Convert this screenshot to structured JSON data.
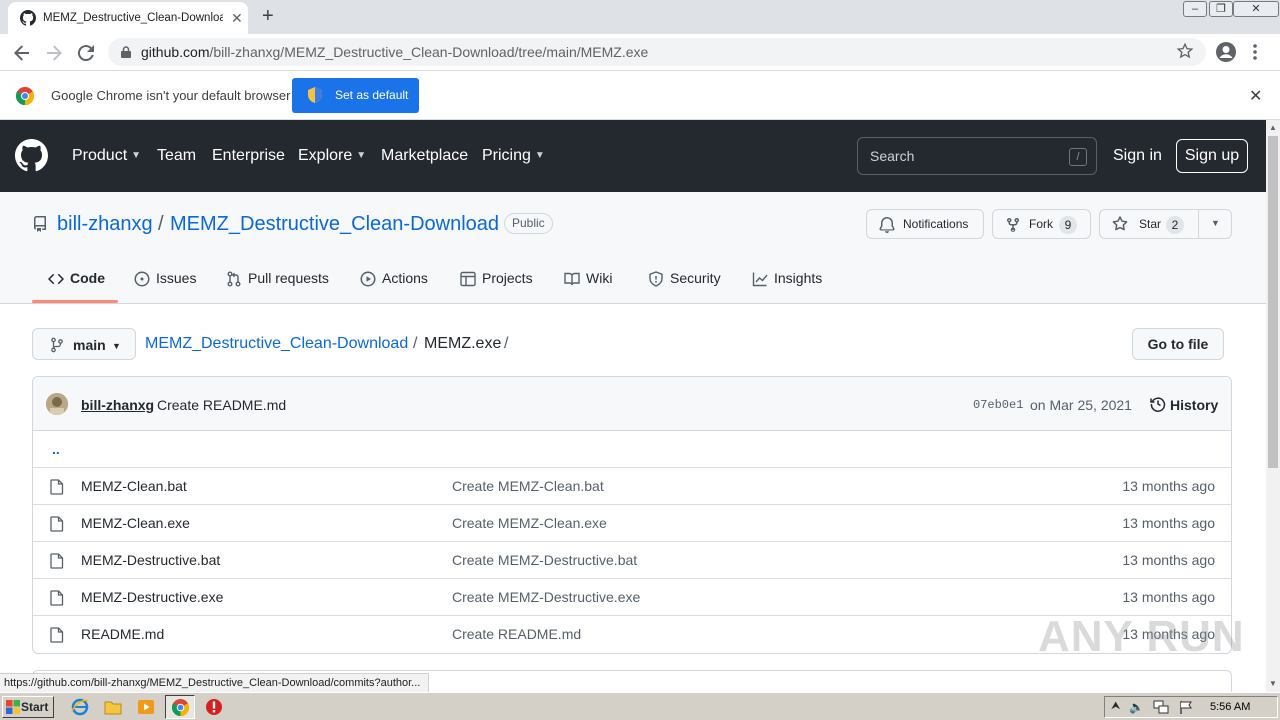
{
  "browser": {
    "tab_title": "MEMZ_Destructive_Clean-Download",
    "url_domain": "github.com",
    "url_path": "/bill-zhanxg/MEMZ_Destructive_Clean-Download/tree/main/MEMZ.exe",
    "infobar_text": "Google Chrome isn't your default browser",
    "set_default_label": "Set as default",
    "status_url": "https://github.com/bill-zhanxg/MEMZ_Destructive_Clean-Download/commits?author..."
  },
  "gh_nav": {
    "items": [
      "Product",
      "Team",
      "Enterprise",
      "Explore",
      "Marketplace",
      "Pricing"
    ],
    "search_placeholder": "Search",
    "slash_hint": "/",
    "signin": "Sign in",
    "signup": "Sign up"
  },
  "repo": {
    "owner": "bill-zhanxg",
    "separator": "/",
    "name": "MEMZ_Destructive_Clean-Download",
    "visibility": "Public",
    "notifications_label": "Notifications",
    "fork_label": "Fork",
    "fork_count": "9",
    "star_label": "Star",
    "star_count": "2",
    "tabs": [
      "Code",
      "Issues",
      "Pull requests",
      "Actions",
      "Projects",
      "Wiki",
      "Security",
      "Insights"
    ]
  },
  "breadcrumb": {
    "branch": "main",
    "repo_link": "MEMZ_Destructive_Clean-Download",
    "sep": "/",
    "dir": "MEMZ.exe",
    "trailing_sep": "/",
    "goto_file": "Go to file"
  },
  "commit": {
    "author": "bill-zhanxg",
    "message": "Create README.md",
    "sha": "07eb0e1",
    "date": "on Mar 25, 2021",
    "history_label": "History"
  },
  "files": {
    "parent": "..",
    "rows": [
      {
        "name": "MEMZ-Clean.bat",
        "message": "Create MEMZ-Clean.bat",
        "age": "13 months ago"
      },
      {
        "name": "MEMZ-Clean.exe",
        "message": "Create MEMZ-Clean.exe",
        "age": "13 months ago"
      },
      {
        "name": "MEMZ-Destructive.bat",
        "message": "Create MEMZ-Destructive.bat",
        "age": "13 months ago"
      },
      {
        "name": "MEMZ-Destructive.exe",
        "message": "Create MEMZ-Destructive.exe",
        "age": "13 months ago"
      },
      {
        "name": "README.md",
        "message": "Create README.md",
        "age": "13 months ago"
      }
    ]
  },
  "watermark": "ANY RUN",
  "taskbar": {
    "start_label": "Start",
    "clock": "5:56 AM"
  },
  "colors": {
    "gh_header": "#24292f",
    "link": "#0969da",
    "chrome_blue": "#1a73e8",
    "tab_underline": "#fd8c73"
  }
}
